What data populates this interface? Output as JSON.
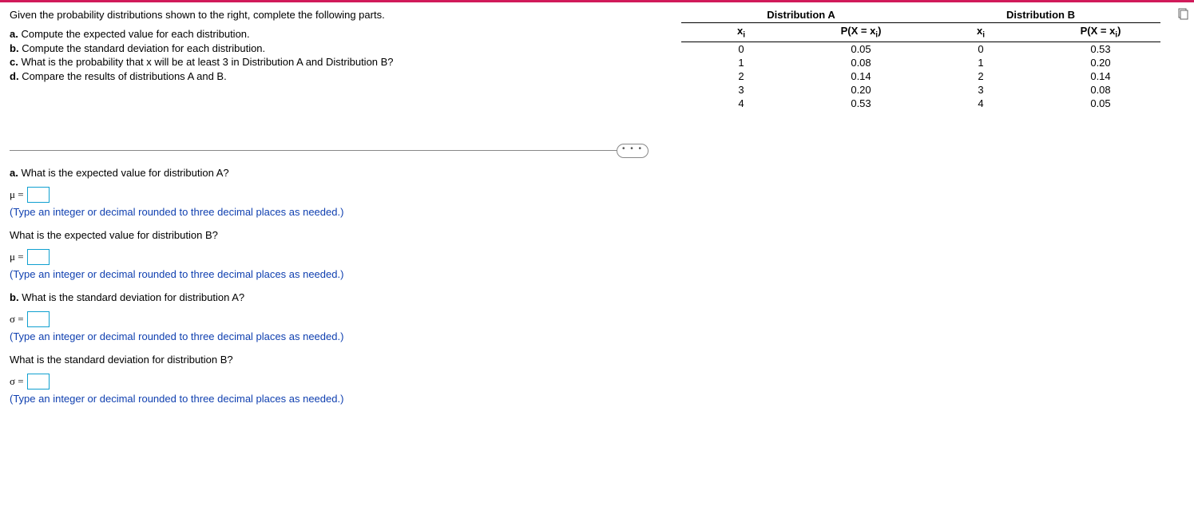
{
  "intro": "Given the probability distributions shown to the right, complete the following parts.",
  "parts": {
    "a": {
      "label": "a.",
      "text": "Compute the expected value for each distribution."
    },
    "b": {
      "label": "b.",
      "text": "Compute the standard deviation for each distribution."
    },
    "c": {
      "label": "c.",
      "text": "What is the probability that x will be at least 3 in Distribution A and Distribution B?"
    },
    "d": {
      "label": "d.",
      "text": "Compare the results of distributions A and B."
    }
  },
  "distA": {
    "title": "Distribution A",
    "col1": "xᵢ",
    "col2": "P(X = xᵢ)",
    "rows": [
      {
        "x": "0",
        "p": "0.05"
      },
      {
        "x": "1",
        "p": "0.08"
      },
      {
        "x": "2",
        "p": "0.14"
      },
      {
        "x": "3",
        "p": "0.20"
      },
      {
        "x": "4",
        "p": "0.53"
      }
    ]
  },
  "distB": {
    "title": "Distribution B",
    "col1": "xᵢ",
    "col2": "P(X = xᵢ)",
    "rows": [
      {
        "x": "0",
        "p": "0.53"
      },
      {
        "x": "1",
        "p": "0.20"
      },
      {
        "x": "2",
        "p": "0.14"
      },
      {
        "x": "3",
        "p": "0.08"
      },
      {
        "x": "4",
        "p": "0.05"
      }
    ]
  },
  "dots": "• • •",
  "q": {
    "a1": {
      "label": "a.",
      "text": "What is the expected value for distribution A?"
    },
    "a1sym": "μ =",
    "hint": "(Type an integer or decimal rounded to three decimal places as needed.)",
    "a2text": "What is the expected value for distribution B?",
    "a2sym": "μ =",
    "b1": {
      "label": "b.",
      "text": "What is the standard deviation for distribution A?"
    },
    "b1sym": "σ =",
    "b2text": "What is the standard deviation for distribution B?",
    "b2sym": "σ ="
  }
}
